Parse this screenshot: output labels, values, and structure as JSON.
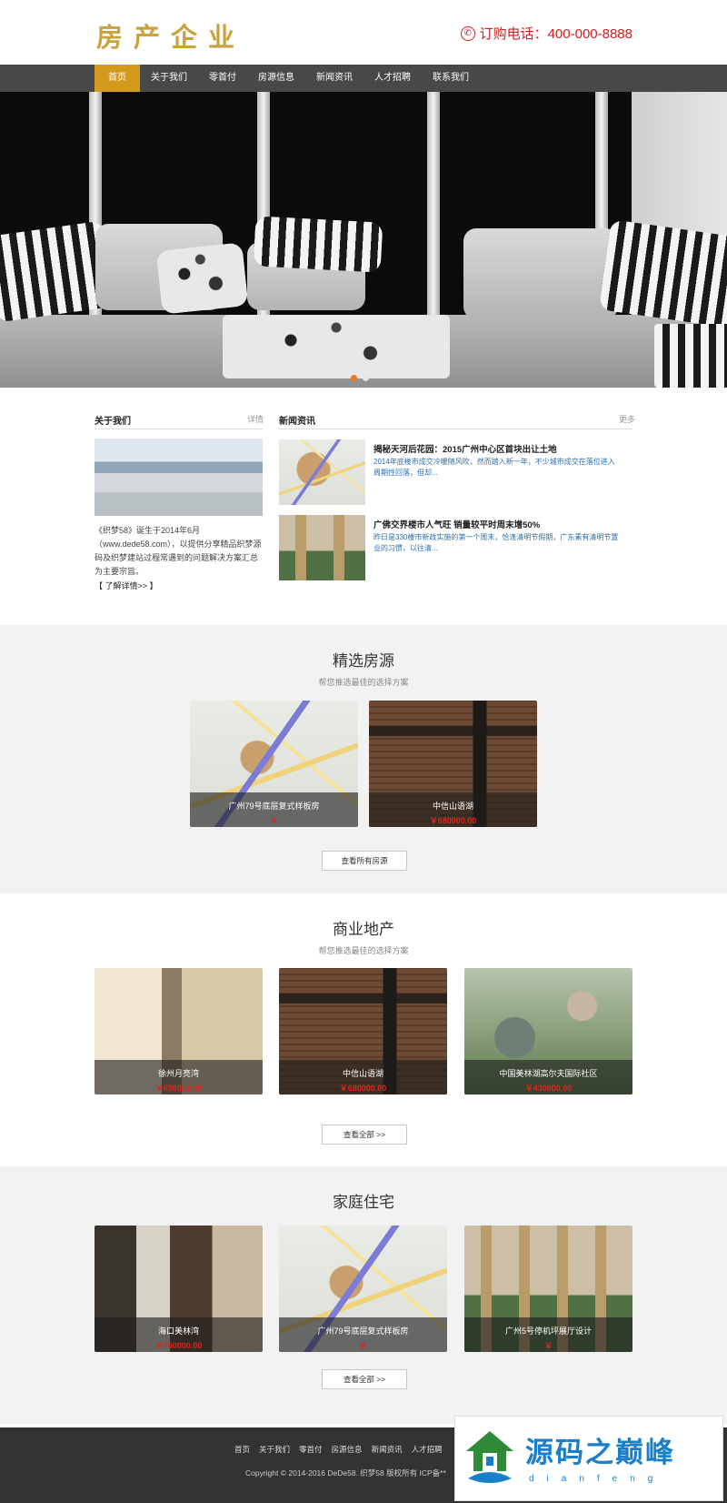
{
  "header": {
    "logo": "房产企业",
    "phone": "订购电话：400-000-8888"
  },
  "nav": [
    "首页",
    "关于我们",
    "零首付",
    "房源信息",
    "新闻资讯",
    "人才招聘",
    "联系我们"
  ],
  "about": {
    "title": "关于我们",
    "more": "详情",
    "text": "《织梦58》诞生于2014年6月（www.dede58.com），以提供分享精品织梦源码及织梦建站过程常遇到的问题解决方案汇总为主要宗旨。",
    "link": "【 了解详情>> 】"
  },
  "news": {
    "title": "新闻资讯",
    "more": "更多",
    "items": [
      {
        "title": "揭秘天河后花园：2015广州中心区首块出让土地",
        "desc": "2014年底楼市成交冷暖随风吹，然而踏入新一年，不少城市成交在落位进入周期性回落，但却..."
      },
      {
        "title": "广佛交界楼市人气旺 销量较平时周末增50%",
        "desc": "昨日是330楼市新政实施的第一个周末，恰逢清明节假期，广东素有清明节置业的习惯，以往清..."
      }
    ]
  },
  "featured": {
    "title": "精选房源",
    "subtitle": "帮您推选最佳的选择方案",
    "items": [
      {
        "name": "广州79号底层复式样板房",
        "price": "￥"
      },
      {
        "name": "中信山语湖",
        "price": "￥680000.00"
      }
    ],
    "button": "查看所有房源"
  },
  "commercial": {
    "title": "商业地产",
    "subtitle": "帮您推选最佳的选择方案",
    "items": [
      {
        "name": "徐州月亮湾",
        "price": "￥650000.00"
      },
      {
        "name": "中信山语湖",
        "price": "￥680000.00"
      },
      {
        "name": "中国美林湖高尔夫国际社区",
        "price": "￥430000.00"
      }
    ],
    "button": "查看全部 >>"
  },
  "residential": {
    "title": "家庭住宅",
    "items": [
      {
        "name": "海口美林湾",
        "price": "￥750000.00"
      },
      {
        "name": "广州79号底层复式样板房",
        "price": "￥"
      },
      {
        "name": "广州5号停机坪展厅设计",
        "price": "￥"
      }
    ],
    "button": "查看全部 >>"
  },
  "footer": {
    "links": [
      "首页",
      "关于我们",
      "零首付",
      "房源信息",
      "新闻资讯",
      "人才招聘"
    ],
    "copyright": "Copyright © 2014-2016 DeDe58. 织梦58 版权所有 ICP备**"
  },
  "watermark": {
    "title": "源码之巅峰",
    "subtitle": "dianfeng"
  },
  "colors": {
    "nav_active": "#d49a1d",
    "nav_bg": "#484848",
    "price": "#e1251b",
    "logo": "#c8a23c",
    "phone": "#d21d1d"
  }
}
